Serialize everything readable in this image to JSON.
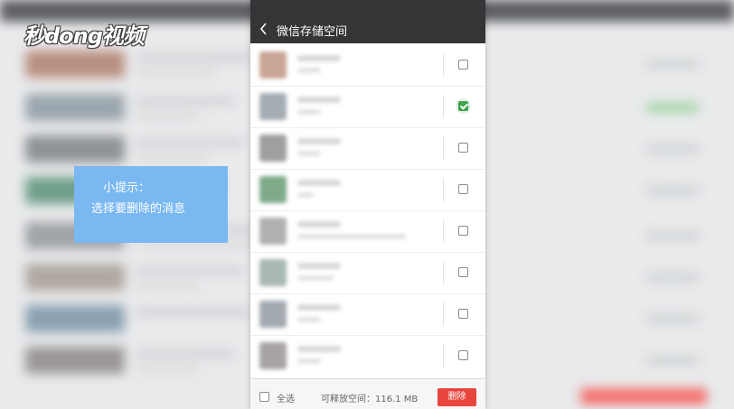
{
  "logo": {
    "text": "秒dong视频"
  },
  "tip": {
    "title": "小提示：",
    "text": "选择要删除的消息"
  },
  "app": {
    "title": "微信存储空间",
    "rows": [
      {
        "checked": false
      },
      {
        "checked": true
      },
      {
        "checked": false
      },
      {
        "checked": false
      },
      {
        "checked": false
      },
      {
        "checked": false
      },
      {
        "checked": false
      },
      {
        "checked": false
      }
    ],
    "footer": {
      "select_all_label": "全选",
      "free_space": "可释放空间：116.1 MB",
      "delete_label": "删除"
    }
  },
  "colors": {
    "titlebar": "#343536",
    "check_on": "#3ea34b",
    "delete": "#e9453f",
    "tip_bg": "#7ab8f2"
  }
}
